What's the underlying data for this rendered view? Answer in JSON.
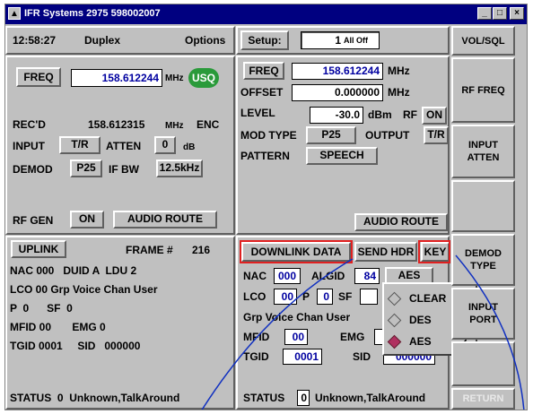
{
  "window": {
    "title": "IFR Systems 2975 598002007"
  },
  "toolbar": {
    "time": "12:58:27",
    "mode": "Duplex",
    "options": "Options",
    "setup_label": "Setup:",
    "setup_num": "1",
    "setup_name": "All Off"
  },
  "rx": {
    "freq_label": "FREQ",
    "freq": "158.612244",
    "freq_unit": "MHz",
    "usq": "USQ",
    "recd_label": "REC'D",
    "recd": "158.612315",
    "recd_unit": "MHz",
    "enc": "ENC",
    "input_label": "INPUT",
    "input": "T/R",
    "atten_label": "ATTEN",
    "atten": "0",
    "atten_unit": "dB",
    "demod_label": "DEMOD",
    "demod": "P25",
    "ifbw_label": "IF BW",
    "ifbw": "12.5kHz",
    "rfgen_label": "RF GEN",
    "rfgen": "ON",
    "audio_route": "AUDIO ROUTE"
  },
  "tx": {
    "freq_label": "FREQ",
    "freq": "158.612244",
    "freq_unit": "MHz",
    "offset_label": "OFFSET",
    "offset": "0.000000",
    "offset_unit": "MHz",
    "level_label": "LEVEL",
    "level": "-30.0",
    "level_unit": "dBm",
    "rf_label": "RF",
    "rf": "ON",
    "modtype_label": "MOD TYPE",
    "modtype": "P25",
    "output_label": "OUTPUT",
    "output": "T/R",
    "pattern_label": "PATTERN",
    "pattern": "SPEECH",
    "audio_route": "AUDIO ROUTE"
  },
  "uplink": {
    "title": "UPLINK",
    "frame_label": "FRAME #",
    "frame": "216",
    "nac_line": "NAC 000   DUID A  LDU 2",
    "lco_line": "LCO 00 Grp Voice Chan User",
    "psf_line": "P  0      SF  0",
    "mfid_line": "MFID 00       EMG 0",
    "tgid_line": "TGID 0001     SID   000000",
    "status_line": "STATUS  0  Unknown,TalkAround"
  },
  "downlink": {
    "title": "DOWNLINK DATA",
    "send_hdr": "SEND HDR",
    "key": "KEY",
    "nac_label": "NAC",
    "nac": "000",
    "algid_label": "ALGID",
    "algid": "84",
    "algid_name": "AES",
    "lco_label": "LCO",
    "lco": "00",
    "p_label": "P",
    "p": "0",
    "sf_label": "SF",
    "grp_voice": "Grp Voice Chan User",
    "mfid_label": "MFID",
    "mfid": "00",
    "emg_label": "EMG",
    "tgid_label": "TGID",
    "tgid": "0001",
    "sid_label": "SID",
    "sid": "000000",
    "status_label": "STATUS",
    "status": "0",
    "status_text": "Unknown,TalkAround"
  },
  "key_menu": {
    "items": [
      {
        "label": "CLEAR",
        "code": "0"
      },
      {
        "label": "DES",
        "code": "1"
      },
      {
        "label": "AES",
        "code": "2"
      }
    ],
    "selected": "AES"
  },
  "side_buttons": [
    "VOL/SQL",
    "RF FREQ",
    "INPUT ATTEN",
    "",
    "DEMOD TYPE",
    "INPUT PORT",
    "",
    "RETURN"
  ],
  "colors": {
    "titlebar": "#000080",
    "panel": "#c0c0c0",
    "value_text": "#0000a0",
    "usq_badge": "#2a9a3a",
    "highlight": "#e02020",
    "annotation_line": "#1030c0"
  }
}
